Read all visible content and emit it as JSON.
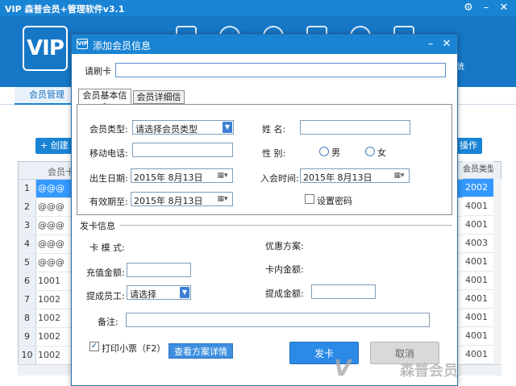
{
  "app": {
    "title": "VIP  森普会员+管理软件v3.1",
    "logo_text": "VIP",
    "header_right_label": "统",
    "nav_tab": "会员管理",
    "toolbar_left": "创建",
    "toolbar_right": "操作"
  },
  "grid": {
    "header": "会员卡号",
    "right_header": "会员类型",
    "rows": [
      {
        "num": "1",
        "card": "@@@",
        "type": "2002",
        "selected": true
      },
      {
        "num": "2",
        "card": "@@@",
        "type": "4001"
      },
      {
        "num": "3",
        "card": "@@@",
        "type": "4001"
      },
      {
        "num": "4",
        "card": "@@@",
        "type": "4003"
      },
      {
        "num": "5",
        "card": "@@@",
        "type": "4001"
      },
      {
        "num": "6",
        "card": "1001",
        "type": "4001"
      },
      {
        "num": "7",
        "card": "1002",
        "type": "4001"
      },
      {
        "num": "8",
        "card": "1002",
        "type": "4001"
      },
      {
        "num": "9",
        "card": "1002",
        "type": "4001"
      },
      {
        "num": "10",
        "card": "1002",
        "type": "4001"
      }
    ]
  },
  "dialog": {
    "icon_text": "VIP",
    "title": "添加会员信息",
    "card_label": "请刷卡",
    "card_value": "",
    "tabs": [
      "会员基本信息",
      "会员详细信息"
    ],
    "basic": {
      "member_type_label": "会员类型:",
      "member_type_value": "请选择会员类型",
      "name_label": "姓    名:",
      "phone_label": "移动电话:",
      "gender_label": "性    别:",
      "gender_male": "男",
      "gender_female": "女",
      "birth_label": "出生日期:",
      "birth_value": "2015年  8月13日",
      "join_label": "入会时间:",
      "join_value": "2015年  8月13日",
      "expire_label": "有效期至:",
      "expire_value": "2015年  8月13日",
      "set_password_label": "设置密码"
    },
    "issue": {
      "section_title": "发卡信息",
      "mode_label": "卡  模  式:",
      "promo_label": "优惠方案:",
      "recharge_label": "充值金额:",
      "balance_label": "卡内金额:",
      "staff_label": "提成员工:",
      "staff_value": "请选择",
      "commission_label": "提成金额:",
      "note_label": "备注:"
    },
    "print_label": "打印小票（F2）",
    "print_checked": true,
    "detail_button": "查看方案详情",
    "issue_button": "发卡",
    "cancel_button": "取消"
  },
  "watermark": {
    "text": "森普会员"
  }
}
